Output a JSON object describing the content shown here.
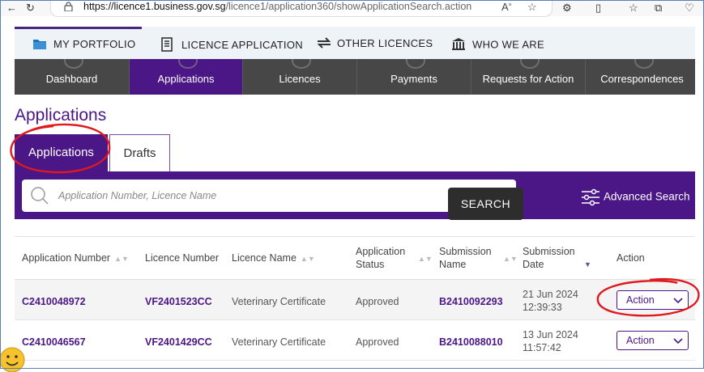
{
  "browser": {
    "url_host": "https://licence1.business.gov.sg",
    "url_path": "/licence1/application360/showApplicationSearch.action"
  },
  "top_menu": {
    "items": [
      {
        "label": "MY PORTFOLIO",
        "icon": "folder-icon"
      },
      {
        "label": "LICENCE APPLICATION",
        "icon": "form-icon"
      },
      {
        "label": "OTHER LICENCES",
        "icon": "arrows-exchange-icon"
      },
      {
        "label": "WHO WE ARE",
        "icon": "building-icon"
      }
    ]
  },
  "nav": {
    "items": [
      {
        "label": "Dashboard",
        "active": false
      },
      {
        "label": "Applications",
        "active": true
      },
      {
        "label": "Licences",
        "active": false
      },
      {
        "label": "Payments",
        "active": false
      },
      {
        "label": "Requests for Action",
        "active": false
      },
      {
        "label": "Correspondences",
        "active": false
      }
    ]
  },
  "page": {
    "title": "Applications"
  },
  "tabs": [
    {
      "label": "Applications",
      "active": true
    },
    {
      "label": "Drafts",
      "active": false
    }
  ],
  "search": {
    "placeholder": "Application Number, Licence Name",
    "button": "SEARCH",
    "advanced": "Advanced Search"
  },
  "table": {
    "headers": {
      "app_no": "Application Number",
      "lic_no": "Licence Number",
      "lic_name": "Licence Name",
      "status_1": "Application",
      "status_2": "Status",
      "sub_name_1": "Submission",
      "sub_name_2": "Name",
      "sub_date_1": "Submission",
      "sub_date_2": "Date",
      "action": "Action"
    },
    "rows": [
      {
        "app_no": "C2410048972",
        "lic_no": "VF2401523CC",
        "lic_name": "Veterinary Certificate",
        "status": "Approved",
        "sub_name": "B2410092293",
        "sub_date": "21 Jun 2024",
        "sub_time": "12:39:33",
        "action": "Action"
      },
      {
        "app_no": "C2410046567",
        "lic_no": "VF2401429CC",
        "lic_name": "Veterinary Certificate",
        "status": "Approved",
        "sub_name": "B2410088010",
        "sub_date": "13 Jun 2024",
        "sub_time": "11:57:42",
        "action": "Action"
      }
    ]
  },
  "colors": {
    "brand_purple": "#4b1685",
    "nav_dark": "#474747",
    "annotation_red": "#e0191e"
  }
}
